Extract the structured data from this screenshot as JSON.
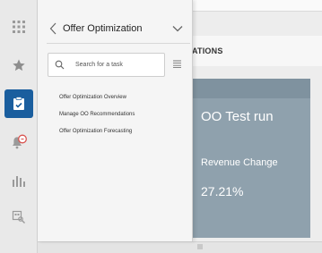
{
  "app": {
    "rail_icons": [
      "apps-grid-icon",
      "star-icon",
      "task-clipboard-icon",
      "notification-bell-icon",
      "analytics-bar-chart-icon",
      "search-people-icon"
    ],
    "active_rail_icon": "task-clipboard-icon",
    "accent_color": "#1a5e9e"
  },
  "nav": {
    "title": "Offer Optimization",
    "search_placeholder": "Search for a task",
    "tasks": [
      "Offer Optimization Overview",
      "Manage OO Recommendations",
      "Offer Optimization Forecasting"
    ]
  },
  "main": {
    "heading_partial": "ATIONS",
    "card": {
      "title": "OO Test run",
      "metric_label": "Revenue Change",
      "metric_value": "27.21%",
      "color": "#8fa1ad"
    }
  }
}
